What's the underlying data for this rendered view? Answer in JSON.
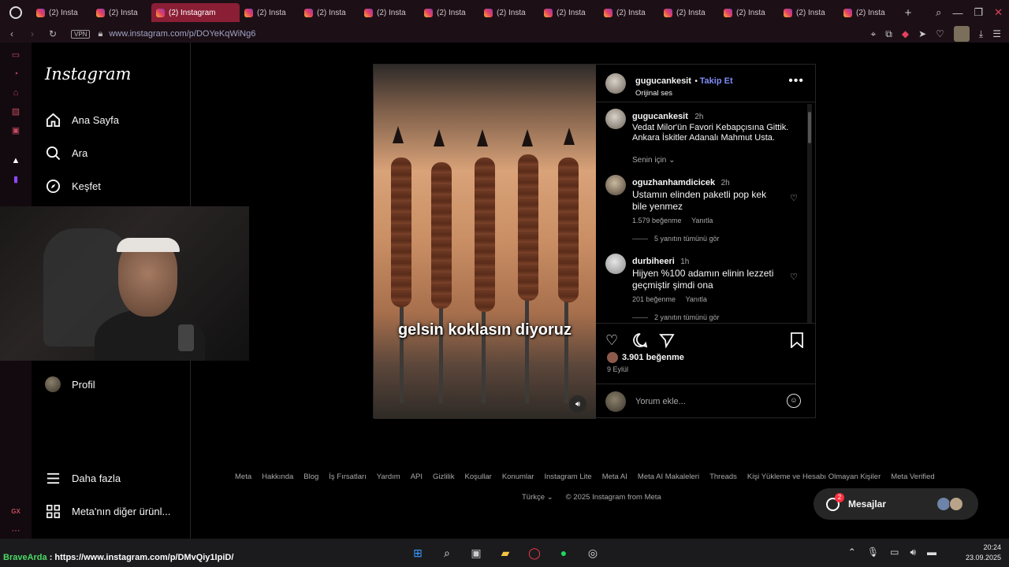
{
  "browser": {
    "tabs": [
      {
        "label": "(2) Insta",
        "active": false
      },
      {
        "label": "(2) Insta",
        "active": false
      },
      {
        "label": "(2) Instagram",
        "active": true
      },
      {
        "label": "(2) Insta",
        "active": false
      },
      {
        "label": "(2) Insta",
        "active": false
      },
      {
        "label": "(2) Insta",
        "active": false
      },
      {
        "label": "(2) Insta",
        "active": false
      },
      {
        "label": "(2) Insta",
        "active": false
      },
      {
        "label": "(2) Insta",
        "active": false
      },
      {
        "label": "(2) Insta",
        "active": false
      },
      {
        "label": "(2) Insta",
        "active": false
      },
      {
        "label": "(2) Insta",
        "active": false
      },
      {
        "label": "(2) Insta",
        "active": false
      },
      {
        "label": "(2) Insta",
        "active": false
      }
    ],
    "vpn_label": "VPN",
    "url": "www.instagram.com/p/DOYeKqWiNg6"
  },
  "nav": {
    "logo": "Instagram",
    "items": [
      {
        "label": "Ana Sayfa",
        "icon": "home-icon"
      },
      {
        "label": "Ara",
        "icon": "search-icon"
      },
      {
        "label": "Keşfet",
        "icon": "compass-icon"
      }
    ],
    "profile": "Profil",
    "more": "Daha fazla",
    "meta_apps": "Meta'nın diğer ürünl..."
  },
  "post": {
    "author": "gugucankesit",
    "follow_label": "Takip Et",
    "audio": "Orijinal ses",
    "subtitle": "gelsin koklasın diyoruz",
    "caption": {
      "user": "gugucankesit",
      "time": "2h",
      "text": "Vedat Milor'ün Favori Kebapçısına Gittik. Ankara İskitler Adanalı Mahmut Usta.",
      "for_you": "Senin için"
    },
    "comments": [
      {
        "user": "oguzhanhamdicicek",
        "time": "2h",
        "text": "Ustamın elinden paketli pop kek bile yenmez",
        "likes": "1.579 beğenme",
        "reply": "Yanıtla",
        "view_replies": "5 yanıtın tümünü gör"
      },
      {
        "user": "durbiheeri",
        "time": "1h",
        "text": "Hijyen %100 adamın elinin lezzeti geçmiştir şimdi ona",
        "likes": "201 beğenme",
        "reply": "Yanıtla",
        "view_replies": "2 yanıtın tümünü gör"
      }
    ],
    "like_count": "3.901 beğenme",
    "date": "9 Eylül",
    "add_comment_placeholder": "Yorum ekle..."
  },
  "footer": {
    "links": [
      "Meta",
      "Hakkında",
      "Blog",
      "İş Fırsatları",
      "Yardım",
      "API",
      "Gizlilik",
      "Koşullar",
      "Konumlar",
      "Instagram Lite",
      "Meta AI",
      "Meta AI Makaleleri",
      "Threads",
      "Kişi Yükleme ve Hesabı Olmayan Kişiler",
      "Meta Verified"
    ],
    "language": "Türkçe",
    "copyright": "© 2025 Instagram from Meta"
  },
  "messages": {
    "label": "Mesajlar",
    "badge": "2"
  },
  "taskbar": {
    "status_user": "BraveArda",
    "status_url": ": https://www.instagram.com/p/DMvQiy1IpiD/",
    "time": "20:24",
    "date": "23.09.2025"
  },
  "colors": {
    "accent_follow": "#7f8cf7",
    "active_tab": "#8a1e35",
    "notification": "#ff3040"
  }
}
